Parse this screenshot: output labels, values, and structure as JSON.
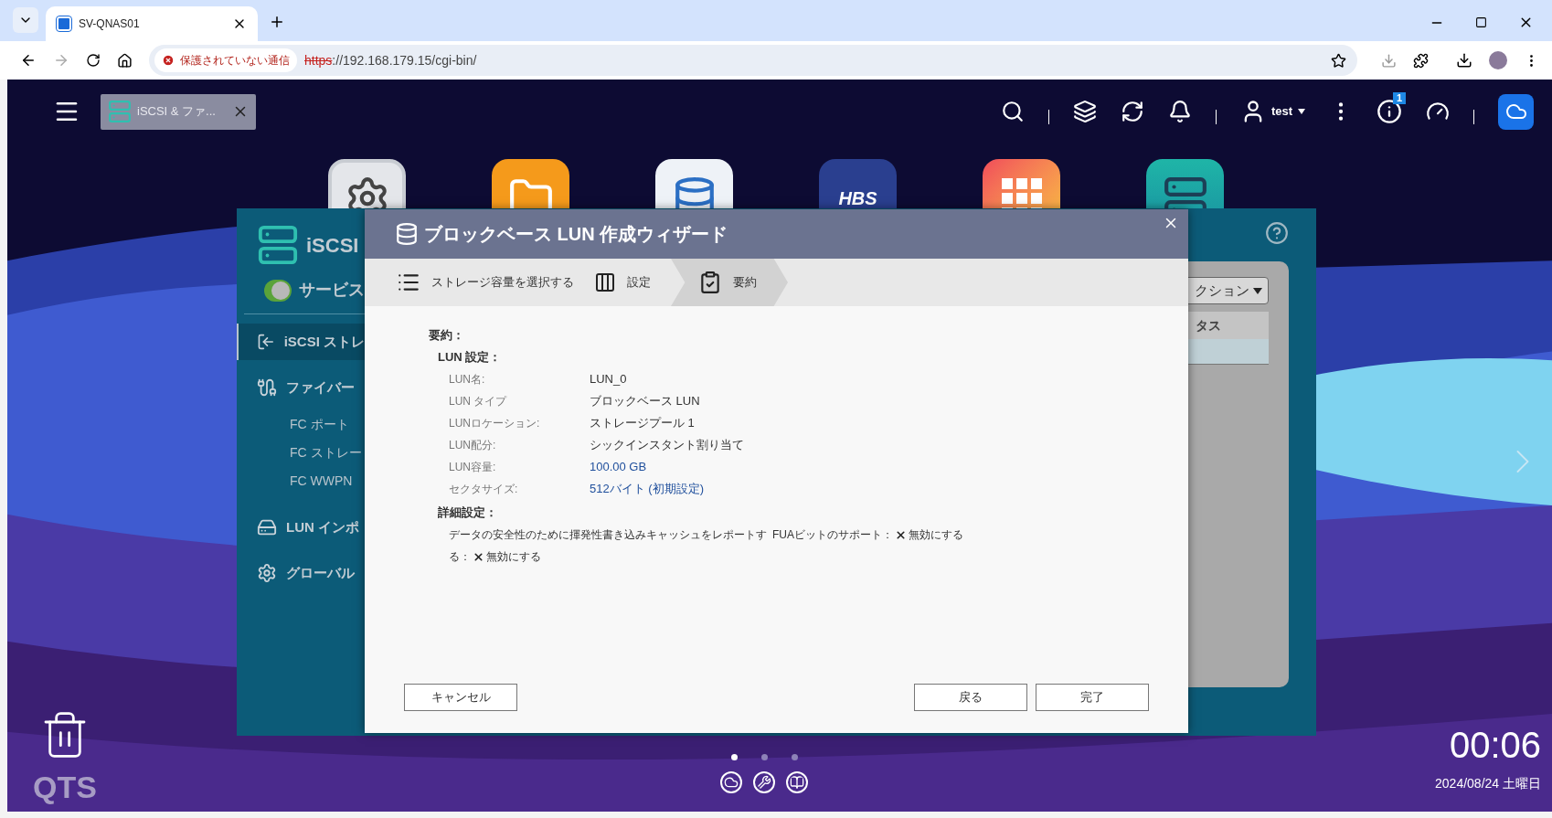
{
  "browser": {
    "tabs": [
      {
        "title": "SV-QNAS01",
        "selected": true
      }
    ],
    "security_label": "保護されていない通信",
    "url_scheme": "https",
    "url_rest": "://192.168.179.15/cgi-bin/"
  },
  "desktop": {
    "taskbar_tab": "iSCSI & ファ...",
    "user": "test",
    "info_badge": "1",
    "app_icons": [
      {
        "kind": "gear"
      },
      {
        "kind": "folder"
      },
      {
        "kind": "database"
      },
      {
        "kind": "hbs",
        "label": "HBS"
      },
      {
        "kind": "grid"
      },
      {
        "kind": "server"
      }
    ],
    "clock": "00:06",
    "date": "2024/08/24 土曜日",
    "logo": "QTS",
    "pages": [
      {
        "selected": true
      },
      {
        "selected": false
      },
      {
        "selected": false
      }
    ]
  },
  "background_window": {
    "title": "iSCSI",
    "service": {
      "label": "サービス",
      "on": true
    },
    "nav": [
      {
        "label": "iSCSI ストレ",
        "selected": true
      },
      {
        "label": "ファイバー",
        "selected": false,
        "children": [
          {
            "label": "FC ポート"
          },
          {
            "label": "FC ストレー"
          },
          {
            "label": "FC WWPN"
          }
        ]
      },
      {
        "label": "LUN インポ",
        "selected": false
      },
      {
        "label": "グローバル",
        "selected": false
      }
    ],
    "action_dropdown": "クション",
    "column_header": "タス"
  },
  "dialog": {
    "title": "ブロックベース LUN 作成ウィザード",
    "steps": [
      {
        "label": "ストレージ容量を選択する",
        "selected": false
      },
      {
        "label": "設定",
        "selected": false
      },
      {
        "label": "要約",
        "selected": true
      }
    ],
    "summary_heading": "要約：",
    "lun_heading": "LUN 設定：",
    "rows": [
      {
        "label": "LUN名:",
        "value": "LUN_0",
        "color": "#333333"
      },
      {
        "label": "LUN タイプ",
        "value": "ブロックベース LUN",
        "color": "#333333"
      },
      {
        "label": "LUNロケーション:",
        "value": "ストレージプール 1",
        "color": "#333333"
      },
      {
        "label": "LUN配分:",
        "value": "シックインスタント割り当て",
        "color": "#333333"
      },
      {
        "label": "LUN容量:",
        "value": "100.00 GB",
        "color": "#1f4f9c"
      },
      {
        "label": "セクタサイズ:",
        "value": "512バイト (初期設定)",
        "color": "#1f4f9c"
      }
    ],
    "advanced_heading": "詳細設定：",
    "advanced": [
      {
        "label": "データの安全性のために揮発性書き込みキャッシュをレポートする：",
        "value": "無効にする",
        "enabled": false
      },
      {
        "label": "FUAビットのサポート：",
        "value": "無効にする",
        "enabled": false
      }
    ],
    "buttons": {
      "cancel": "キャンセル",
      "back": "戻る",
      "finish": "完了"
    }
  }
}
